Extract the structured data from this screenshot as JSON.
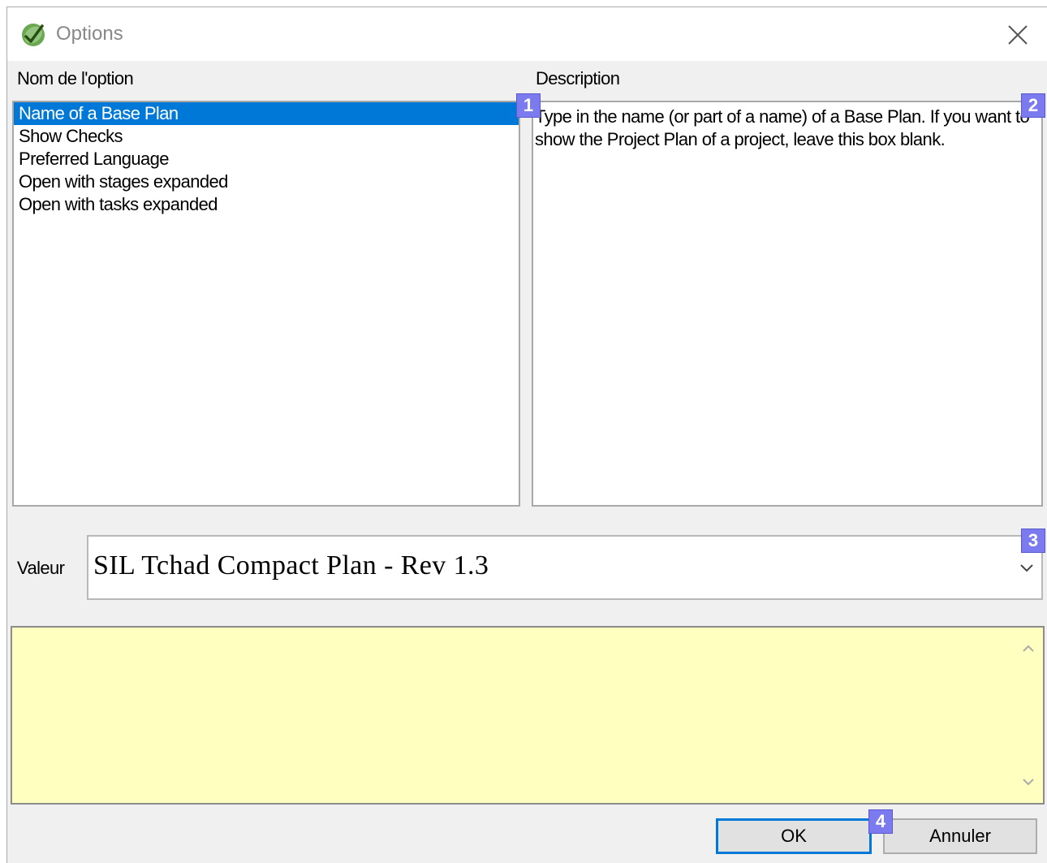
{
  "window": {
    "title": "Options"
  },
  "labels": {
    "option_name": "Nom de l'option",
    "description": "Description",
    "value": "Valeur"
  },
  "options_list": {
    "items": [
      {
        "label": "Name of a Base Plan",
        "selected": true
      },
      {
        "label": "Show Checks",
        "selected": false
      },
      {
        "label": "Preferred Language",
        "selected": false
      },
      {
        "label": "Open with stages expanded",
        "selected": false
      },
      {
        "label": "Open with tasks expanded",
        "selected": false
      }
    ]
  },
  "description_text": "Type in the name (or part of a name) of a Base Plan. If you want to show the Project Plan of a project, leave this box blank.",
  "value_combo": {
    "selected": "SIL Tchad Compact Plan - Rev 1.3"
  },
  "buttons": {
    "ok": "OK",
    "cancel": "Annuler"
  },
  "badges": [
    "1",
    "2",
    "3",
    "4"
  ],
  "colors": {
    "selection": "#0078d7",
    "notes_bg": "#ffffc0",
    "badge": "#7b7bef",
    "app_icon": "#6aa84f"
  },
  "icons": {
    "app": "leaf-check-icon",
    "close": "close-icon",
    "dropdown": "chevron-down-icon",
    "scroll_up": "chevron-up-icon",
    "scroll_down": "chevron-down-icon"
  }
}
